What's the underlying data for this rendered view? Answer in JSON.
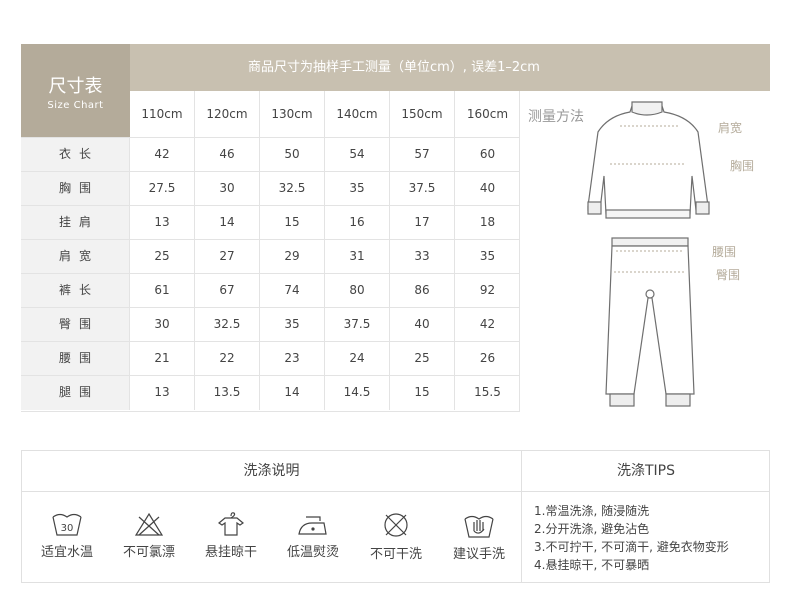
{
  "size_table": {
    "title_zh": "尺寸表",
    "title_en": "Size Chart",
    "banner": "商品尺寸为抽样手工测量（单位cm）, 误差1–2cm",
    "sizes": [
      "110cm",
      "120cm",
      "130cm",
      "140cm",
      "150cm",
      "160cm"
    ],
    "rows": [
      {
        "label": "衣长",
        "values": [
          "42",
          "46",
          "50",
          "54",
          "57",
          "60"
        ]
      },
      {
        "label": "胸围",
        "values": [
          "27.5",
          "30",
          "32.5",
          "35",
          "37.5",
          "40"
        ]
      },
      {
        "label": "挂肩",
        "values": [
          "13",
          "14",
          "15",
          "16",
          "17",
          "18"
        ]
      },
      {
        "label": "肩宽",
        "values": [
          "25",
          "27",
          "29",
          "31",
          "33",
          "35"
        ]
      },
      {
        "label": "裤长",
        "values": [
          "61",
          "67",
          "74",
          "80",
          "86",
          "92"
        ]
      },
      {
        "label": "臀围",
        "values": [
          "30",
          "32.5",
          "35",
          "37.5",
          "40",
          "42"
        ]
      },
      {
        "label": "腰围",
        "values": [
          "21",
          "22",
          "23",
          "24",
          "25",
          "26"
        ]
      },
      {
        "label": "腿围",
        "values": [
          "13",
          "13.5",
          "14",
          "14.5",
          "15",
          "15.5"
        ]
      }
    ]
  },
  "measure": {
    "title": "测量方法",
    "shoulder": "肩宽",
    "chest": "胸围",
    "waist": "腰围",
    "hip": "臀围"
  },
  "washing": {
    "title": "洗涤说明",
    "tips_title": "洗涤TIPS",
    "temp_badge": "30",
    "items": [
      {
        "label": "适宜水温",
        "icon": "wash-30-icon"
      },
      {
        "label": "不可氯漂",
        "icon": "no-bleach-icon"
      },
      {
        "label": "悬挂晾干",
        "icon": "hang-dry-icon"
      },
      {
        "label": "低温熨烫",
        "icon": "low-iron-icon"
      },
      {
        "label": "不可干洗",
        "icon": "no-dry-clean-icon"
      },
      {
        "label": "建议手洗",
        "icon": "hand-wash-icon"
      }
    ],
    "tips": [
      "1.常温洗涤, 随浸随洗",
      "2.分开洗涤, 避免沾色",
      "3.不可拧干, 不可滴干, 避免衣物变形",
      "4.悬挂晾干, 不可暴晒"
    ]
  },
  "colors": {
    "header": "#b4ab9a",
    "banner": "#c8c0b0",
    "label_bg": "#f2f2f2",
    "accent": "#b4ab9a"
  }
}
